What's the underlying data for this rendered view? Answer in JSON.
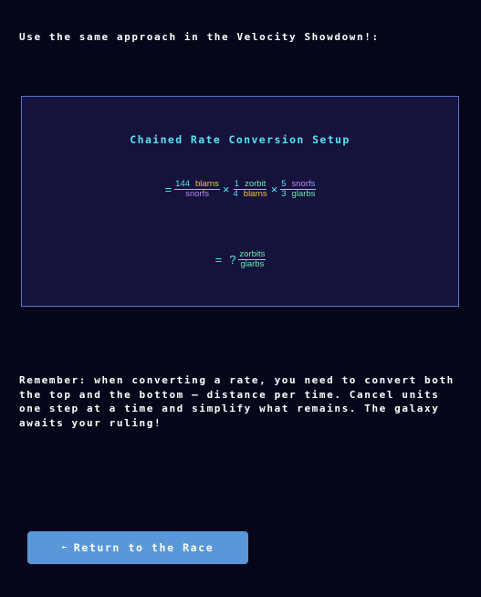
{
  "intro_text": "Use the same approach in the Velocity Showdown!:",
  "panel": {
    "title": "Chained Rate Conversion Setup",
    "equation1": {
      "equals": "=",
      "term1": {
        "num_value": "144",
        "num_unit": "blarns",
        "den_unit": "snorfs"
      },
      "times1": "×",
      "term2": {
        "num_value": "1",
        "num_unit": "zorbit",
        "den_value": "4",
        "den_unit": "blarns"
      },
      "times2": "×",
      "term3": {
        "num_value": "5",
        "num_unit": "snorfs",
        "den_value": "3",
        "den_unit": "glarbs"
      }
    },
    "equation2": {
      "equals": "=",
      "unknown": "?",
      "num_unit": "zorbits",
      "den_unit": "glarbs"
    }
  },
  "remember_text": "Remember: when converting a rate, you need to convert both the top and the bottom — distance per time. Cancel units one step at a time and simplify what remains. The galaxy awaits your ruling!",
  "return_button": {
    "arrow": "←",
    "label": "Return to the Race"
  },
  "colors": {
    "background": "#06061a",
    "panel_bg": "#15123c",
    "panel_border": "#5a72c8",
    "accent_cyan": "#57e3f0",
    "unit_yellow": "#f0c23a",
    "unit_purple": "#b98af5",
    "unit_green": "#66e8b0",
    "button_bg": "#5a97d8"
  }
}
